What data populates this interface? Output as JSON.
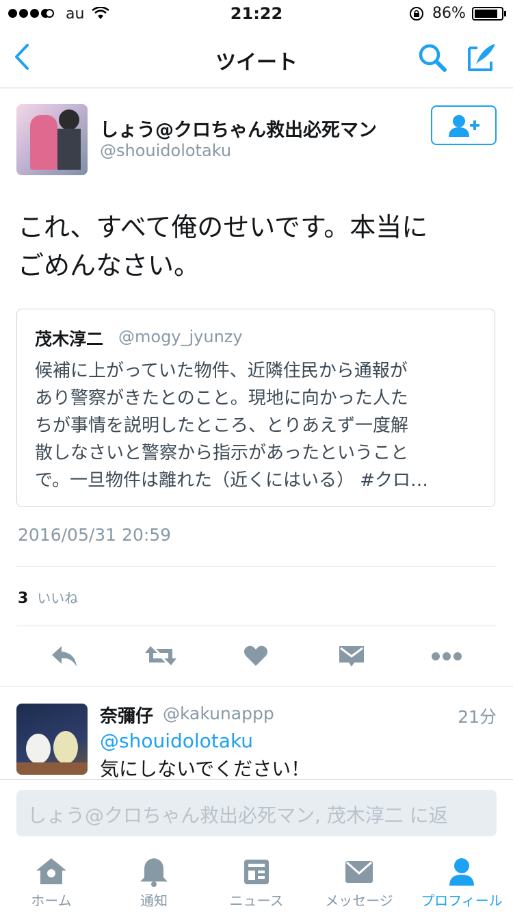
{
  "status_bar": {
    "carrier": "au",
    "time": "21:22",
    "battery_percent": "86%",
    "battery_level": 0.86
  },
  "nav": {
    "title": "ツイート"
  },
  "tweet": {
    "author_name": "しょう@クロちゃん救出必死マン",
    "author_handle": "@shouidolotaku",
    "text_line1": "これ、すべて俺のせいです。本当に",
    "text_line2": "ごめんなさい。",
    "timestamp": "2016/05/31 20:59",
    "likes_count": "3",
    "likes_label": "いいね"
  },
  "quoted": {
    "name": "茂木淳二",
    "handle": "@mogy_jyunzy",
    "lines": [
      "候補に上がっていた物件、近隣住民から通報が",
      "あり警察がきたとのこと。現地に向かった人た",
      "ちが事情を説明したところ、とりあえず一度解",
      "散しなさいと警察から指示があったということ",
      "で。一旦物件は離れた（近くにはいる） #クロ…"
    ]
  },
  "reply": {
    "name": "奈彌仔",
    "handle": "@kakunappp",
    "time": "21分",
    "mention": "@shouidolotaku",
    "text": "気にしないでください！"
  },
  "compose": {
    "placeholder": "しょう@クロちゃん救出必死マン, 茂木淳二 に返"
  },
  "tabs": [
    {
      "label": "ホーム",
      "icon": "home-icon"
    },
    {
      "label": "通知",
      "icon": "bell-icon"
    },
    {
      "label": "ニュース",
      "icon": "news-icon"
    },
    {
      "label": "メッセージ",
      "icon": "envelope-icon"
    },
    {
      "label": "プロフィール",
      "icon": "person-icon"
    }
  ],
  "colors": {
    "accent": "#1da1f2",
    "muted": "#8899a6",
    "text": "#14171a",
    "icon_gray": "#8899a6"
  }
}
